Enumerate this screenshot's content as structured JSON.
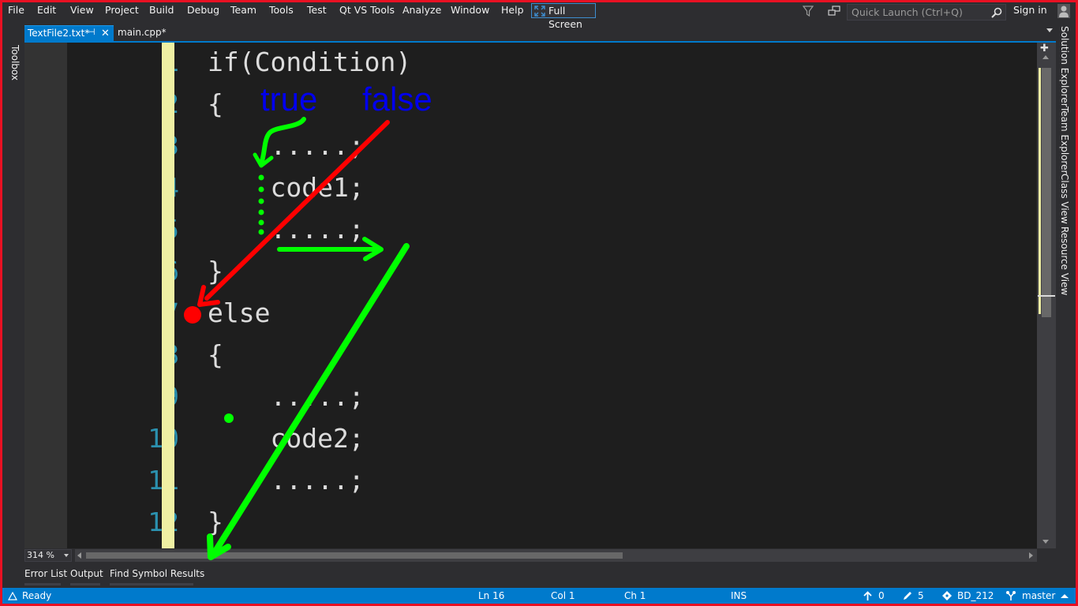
{
  "menu": [
    "File",
    "Edit",
    "View",
    "Project",
    "Build",
    "Debug",
    "Team",
    "Tools",
    "Test",
    "Qt VS Tools",
    "Analyze",
    "Window",
    "Help"
  ],
  "full_screen_label": "Full Screen",
  "quick_launch_placeholder": "Quick Launch (Ctrl+Q)",
  "sign_in": "Sign in",
  "toolbox_label": "Toolbox",
  "tabs": [
    {
      "label": "TextFile2.txt*",
      "active": true
    },
    {
      "label": "main.cpp*",
      "active": false
    }
  ],
  "editor": {
    "line_numbers": [
      "1",
      "2",
      "3",
      "4",
      "5",
      "6",
      "7",
      "8",
      "9",
      "10",
      "11",
      "12"
    ],
    "lines": [
      "if(Condition)",
      "{",
      "    .....;",
      "    code1;",
      "    .....;",
      "}",
      "else",
      "{",
      "    .....;",
      "    code2;",
      "    .....;",
      "}"
    ],
    "annotations": {
      "true_label": "true",
      "false_label": "false"
    }
  },
  "zoom": "314 %",
  "right_tabs": [
    "Solution Explorer",
    "Team Explorer",
    "Class View",
    "Resource View"
  ],
  "bottom_tabs": [
    "Error List",
    "Output",
    "Find Symbol Results"
  ],
  "status": {
    "ready": "Ready",
    "ln": "Ln 16",
    "col": "Col 1",
    "ch": "Ch 1",
    "mode": "INS",
    "up_count": "0",
    "pencil_count": "5",
    "repo": "BD_212",
    "branch": "master"
  },
  "colors": {
    "accent": "#007acc",
    "frame": "#e81123",
    "line_number": "#2b91af",
    "annotation_red": "#ff0000",
    "annotation_green": "#00ff00",
    "annotation_blue": "#0000ee"
  }
}
